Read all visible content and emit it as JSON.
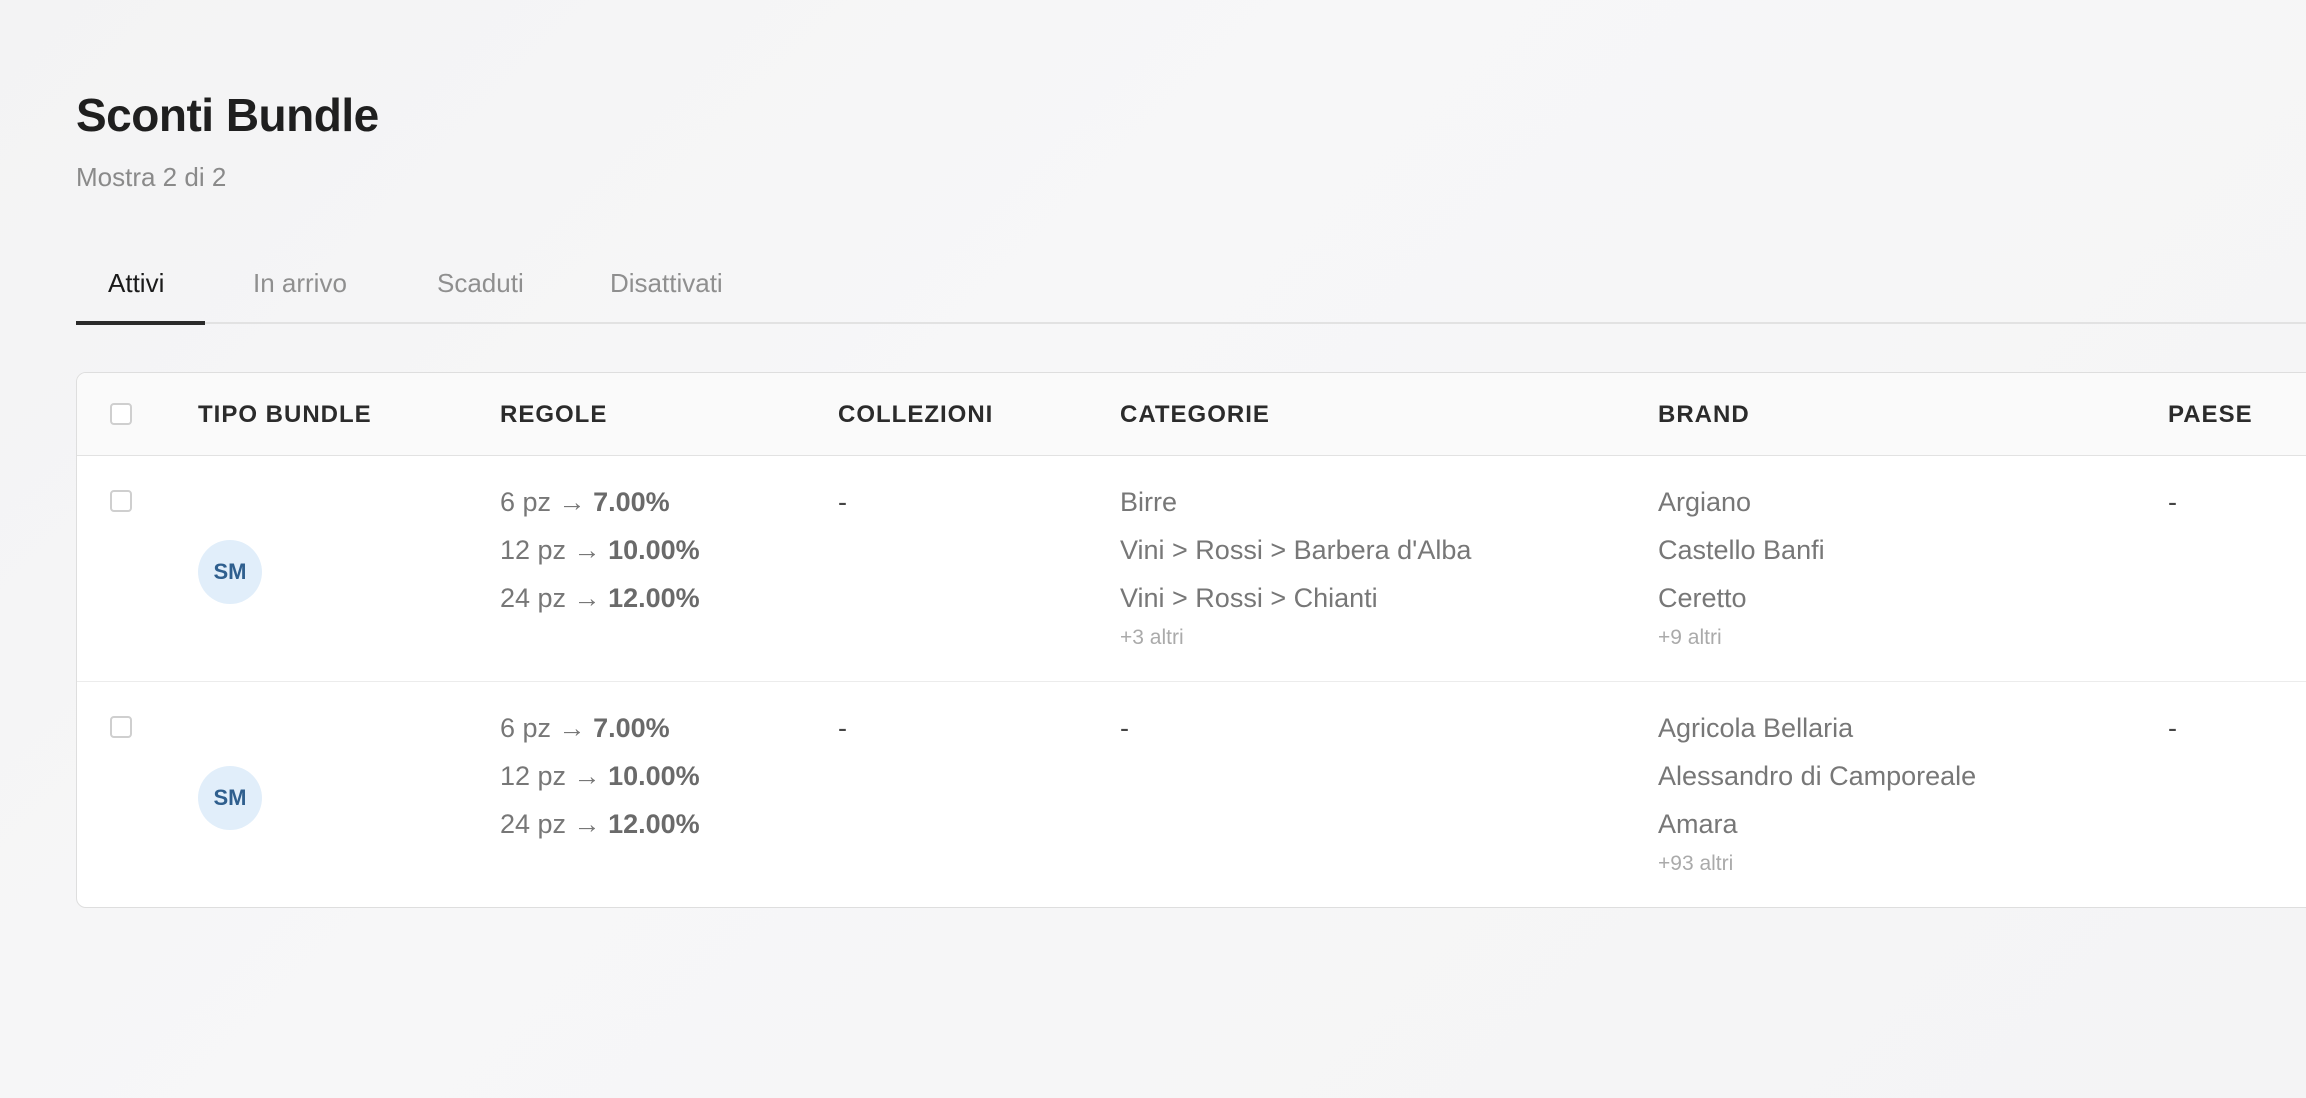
{
  "page": {
    "title": "Sconti Bundle",
    "subtitle": "Mostra 2 di 2"
  },
  "tabs": [
    {
      "label": "Attivi",
      "active": true
    },
    {
      "label": "In arrivo",
      "active": false
    },
    {
      "label": "Scaduti",
      "active": false
    },
    {
      "label": "Disattivati",
      "active": false
    }
  ],
  "table": {
    "headers": {
      "tipo_bundle": "TIPO BUNDLE",
      "regole": "REGOLE",
      "collezioni": "COLLEZIONI",
      "categorie": "CATEGORIE",
      "brand": "BRAND",
      "paese": "PAESE"
    },
    "rows": [
      {
        "tipo_bundle": "SM",
        "regole": [
          {
            "qty": "6 pz →",
            "pct": "7.00%"
          },
          {
            "qty": "12 pz →",
            "pct": "10.00%"
          },
          {
            "qty": "24 pz →",
            "pct": "12.00%"
          }
        ],
        "collezioni": "-",
        "categorie": [
          "Birre",
          "Vini > Rossi > Barbera d'Alba",
          "Vini > Rossi > Chianti"
        ],
        "categorie_more": "+3 altri",
        "brand": [
          "Argiano",
          "Castello Banfi",
          "Ceretto"
        ],
        "brand_more": "+9 altri",
        "paese": "-"
      },
      {
        "tipo_bundle": "SM",
        "regole": [
          {
            "qty": "6 pz →",
            "pct": "7.00%"
          },
          {
            "qty": "12 pz →",
            "pct": "10.00%"
          },
          {
            "qty": "24 pz →",
            "pct": "12.00%"
          }
        ],
        "collezioni": "-",
        "categorie_dash": "-",
        "brand": [
          "Agricola Bellaria",
          "Alessandro di Camporeale",
          "Amara"
        ],
        "brand_more": "+93 altri",
        "paese": "-"
      }
    ]
  }
}
